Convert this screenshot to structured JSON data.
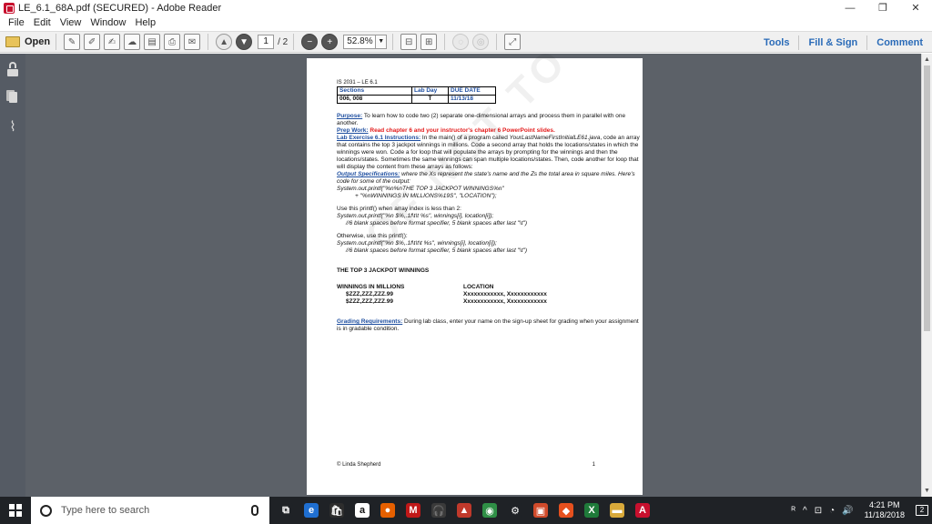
{
  "window": {
    "title": "LE_6.1_68A.pdf (SECURED) - Adobe Reader",
    "controls": [
      "—",
      "❐",
      "✕"
    ]
  },
  "menu": [
    "File",
    "Edit",
    "View",
    "Window",
    "Help"
  ],
  "toolbar": {
    "open_label": "Open",
    "page_current": "1",
    "page_total": "/ 2",
    "zoom": "52.8%",
    "right_links": [
      "Tools",
      "Fill & Sign",
      "Comment"
    ]
  },
  "document": {
    "header": "IS 2031 – LE 6.1",
    "table": {
      "headers": [
        "Sections",
        "Lab Day",
        "DUE DATE"
      ],
      "row": [
        "006, 008",
        "T",
        "11/13/18"
      ]
    },
    "purpose_label": "Purpose:",
    "purpose_text": " To learn how to code two (2) separate one-dimensional arrays and process them in parallel with one another.",
    "prep_label": "Prep Work:",
    "prep_text": " Read chapter 6 and your instructor's chapter 6 PowerPoint slides.",
    "lab_label": "Lab Exercise 6.1 Instructions:",
    "lab_text_a": "  In the main() of a program called ",
    "lab_filename": "YourLastNameFirstInitialLE61.java",
    "lab_text_b": ", code an array that contains the top 3 jackpot winnings in millions.  Code a second array that holds the locations/states in which the winnings were won.  Code a for loop that will populate the arrays by prompting for the winnings and then the locations/states.  Sometimes the same winnings can span multiple locations/states.  Then, code another for loop that will display the content from these arrays as follows:",
    "output_label": "Output Specifications:",
    "output_text": " where the Xs represent the state's name and the Zs the total area in square miles.  Here's code for some of the output:",
    "code1_line1": "System.out.printf(\"%n%nTHE TOP 3 JACKPOT WINNINGS%n\"",
    "code1_line2": "+ \"%nWINNINGS IN MILLIONS%19S\", \"LOCATION\");",
    "use_printf_text": "Use this printf() when array index is less than 2:",
    "code2_line1": "System.out.printf(\"%n      $%,.1f\\t\\t      %s\", winnings[i], location[i]);",
    "code2_line2": "//6 blank spaces before format specifier, 5 blank spaces after last \"\\t\")",
    "otherwise_text": "Otherwise, use this printf():",
    "code3_line1": "System.out.printf(\"%n      $%,.1f\\t\\t\\t      %s\", winnings[i], location[i]);",
    "code3_line2": "//6 blank spaces before format specifier, 5 blank spaces after last \"\\t\")",
    "out_title": "THE TOP 3 JACKPOT WINNINGS",
    "out_col1": "WINNINGS IN MILLIONS",
    "out_col2": "LOCATION",
    "out_rows": [
      [
        "$ZZZ,ZZZ,ZZZ.99",
        "Xxxxxxxxxxxx, Xxxxxxxxxxxx"
      ],
      [
        "$ZZZ,ZZZ,ZZZ.99",
        "Xxxxxxxxxxxx, Xxxxxxxxxxxx"
      ]
    ],
    "grading_label": "Grading Requirements:",
    "grading_text": "  During lab class, enter your name on the sign-up sheet for grading when your assignment is in gradable condition.",
    "footer_left": "© Linda Shepherd",
    "footer_right": "1",
    "watermark": "OF NOT TO POST"
  },
  "taskbar": {
    "search_placeholder": "Type here to search",
    "time": "4:21 PM",
    "date": "11/18/2018",
    "notif_count": "2",
    "apps": [
      {
        "name": "task-view",
        "glyph": "⧉",
        "color": "#1f2226"
      },
      {
        "name": "edge",
        "glyph": "e",
        "color": "#1f6fd1"
      },
      {
        "name": "store",
        "glyph": "🛍",
        "color": "#2d2d2d"
      },
      {
        "name": "amazon",
        "glyph": "a",
        "color": "#ffffff"
      },
      {
        "name": "firefox",
        "glyph": "●",
        "color": "#e66000"
      },
      {
        "name": "mcafee",
        "glyph": "M",
        "color": "#c01818"
      },
      {
        "name": "headphones",
        "glyph": "🎧",
        "color": "#3a3a3a"
      },
      {
        "name": "paint",
        "glyph": "▲",
        "color": "#c0392b"
      },
      {
        "name": "chrome",
        "glyph": "◉",
        "color": "#2f8f46"
      },
      {
        "name": "settings",
        "glyph": "⚙",
        "color": "#1f2226"
      },
      {
        "name": "photos",
        "glyph": "▣",
        "color": "#d04a2a"
      },
      {
        "name": "office",
        "glyph": "◆",
        "color": "#e6501e"
      },
      {
        "name": "excel",
        "glyph": "X",
        "color": "#1f7a3a"
      },
      {
        "name": "file-explorer",
        "glyph": "▬",
        "color": "#d8a93a"
      },
      {
        "name": "acrobat",
        "glyph": "A",
        "color": "#c8102e"
      }
    ],
    "tray": [
      "ᴿ",
      "^",
      "⊡",
      "◔",
      "🔊"
    ]
  },
  "colors": {
    "link_blue": "#2a6bb8",
    "doc_bg": "#5c6168",
    "nav_bg": "#555b64",
    "heading_blue": "#1f4fa0",
    "prep_red": "#e31b1b"
  }
}
